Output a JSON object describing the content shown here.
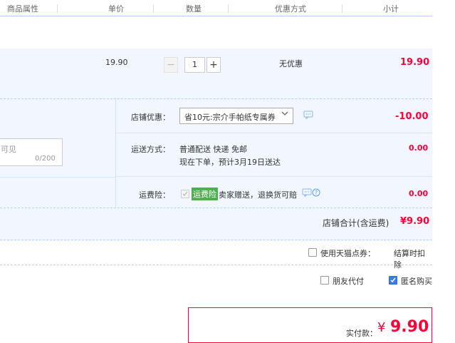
{
  "header": {
    "col_attr": "商品属性",
    "col_price": "单价",
    "col_qty": "数量",
    "col_promo": "优惠方式",
    "col_subtotal": "小计"
  },
  "item": {
    "unit_price": "19.90",
    "quantity": "1",
    "minus": "−",
    "plus": "+",
    "promo": "无优惠",
    "subtotal": "19.90"
  },
  "message": {
    "placeholder_tail": "可见",
    "counter": "0/200"
  },
  "shop_coupon": {
    "label": "店铺优惠：",
    "selected": "省10元:宗介手帕纸专属券",
    "amount": "-10.00"
  },
  "shipping": {
    "label": "运送方式：",
    "method": "普通配送 快递 免邮",
    "note": "现在下单，预计3月19日送达",
    "amount": "0.00"
  },
  "insurance": {
    "label": "运费险：",
    "tag": "运费险",
    "text": "卖家赠送，退换货可赔",
    "amount": "0.00"
  },
  "shop_total": {
    "label": "店铺合计(含运费)",
    "amount": "¥9.90"
  },
  "tmall_points": {
    "label": "使用天猫点券：",
    "note": "结算时扣除"
  },
  "friend_pay": {
    "label": "朋友代付"
  },
  "anonymous": {
    "label": "匿名购买"
  },
  "pay": {
    "label": "实付款：",
    "currency": "¥",
    "amount": "9.90"
  },
  "colors": {
    "accent_blue": "#3b7de9",
    "price_red": "#ff0036",
    "insurance_green": "#4caf50",
    "row_bg": "#f2f7ff"
  },
  "icons": {
    "comment": "comment-icon",
    "help": "help-icon",
    "dropdown": "chevron-down-icon"
  }
}
